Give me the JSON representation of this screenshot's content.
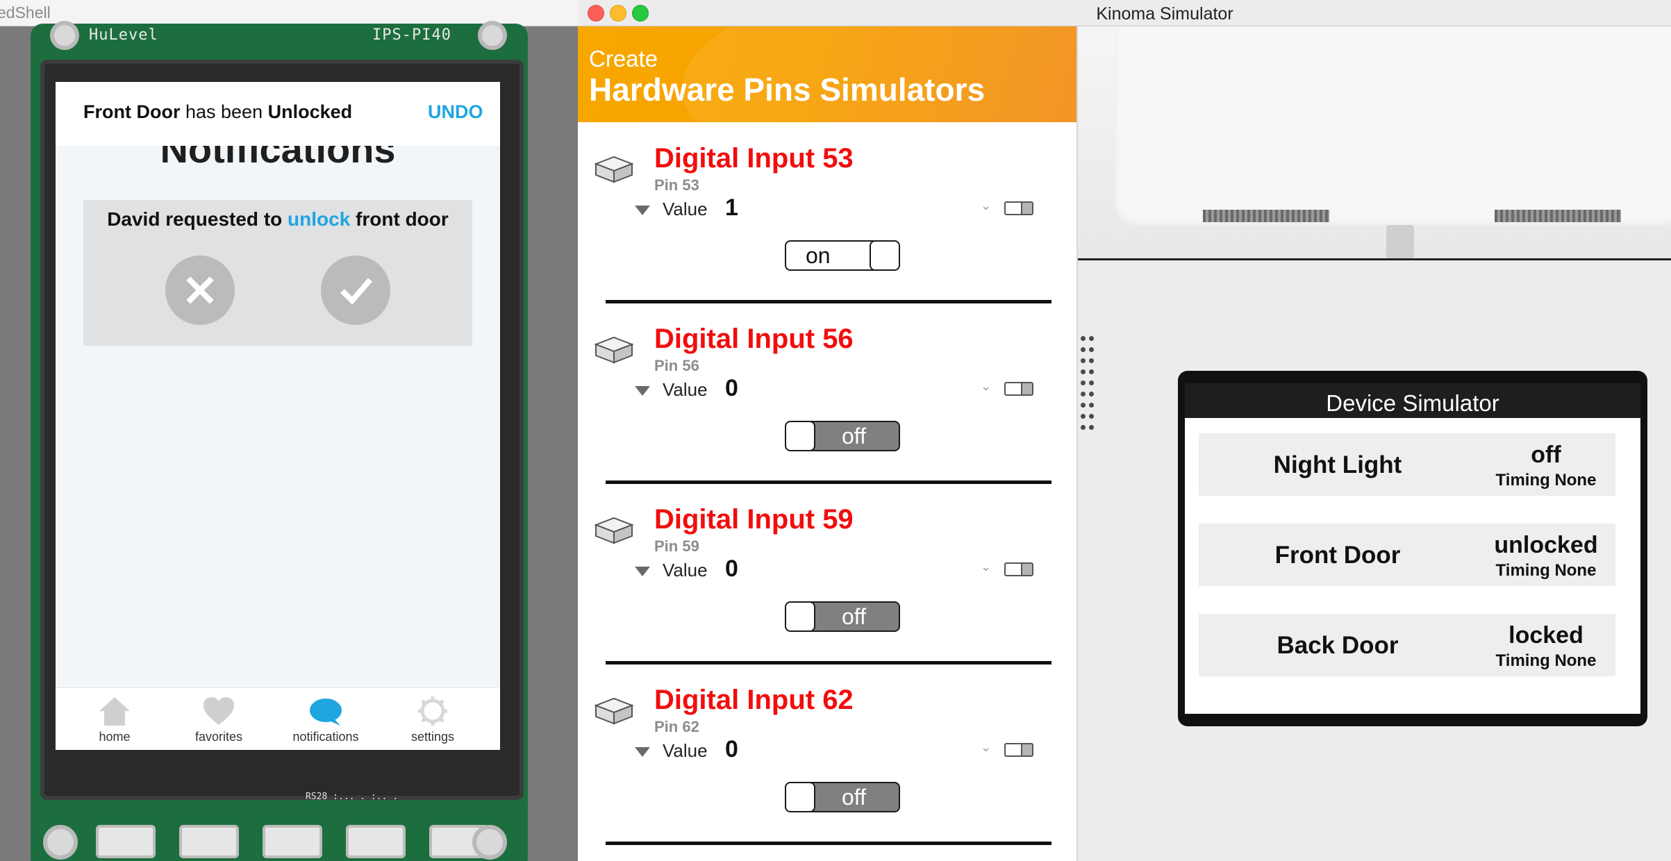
{
  "left_window": {
    "title": "edShell",
    "pcb_label_left": "HuLevel",
    "pcb_label_right": "IPS-PI40",
    "pcb_bottom_label": "RS28 :... . :.. .",
    "toast": {
      "subject": "Front Door",
      "middle": " has been ",
      "state": "Unlocked",
      "undo_label": "UNDO"
    },
    "page_title": "Notifications",
    "request": {
      "before": "David requested to ",
      "action": "unlock",
      "after": " front door"
    },
    "tabs": [
      {
        "label": "home",
        "icon": "home-icon"
      },
      {
        "label": "favorites",
        "icon": "heart-icon"
      },
      {
        "label": "notifications",
        "icon": "chat-bubble-icon"
      },
      {
        "label": "settings",
        "icon": "gear-icon"
      }
    ],
    "active_tab": "notifications",
    "accent_color": "#1fa5e0"
  },
  "right_window": {
    "title": "Kinoma Simulator",
    "pins_panel": {
      "create_label": "Create",
      "title": "Hardware Pins Simulators",
      "value_label": "Value",
      "pins": [
        {
          "name": "Digital Input 53",
          "pin": "Pin 53",
          "value": "1",
          "switch": "on"
        },
        {
          "name": "Digital Input 56",
          "pin": "Pin 56",
          "value": "0",
          "switch": "off"
        },
        {
          "name": "Digital Input 59",
          "pin": "Pin 59",
          "value": "0",
          "switch": "off"
        },
        {
          "name": "Digital Input 62",
          "pin": "Pin 62",
          "value": "0",
          "switch": "off"
        }
      ],
      "accent_color": "#f20d0d",
      "header_color": "#f7a800"
    },
    "device_simulator": {
      "title": "Device Simulator",
      "devices": [
        {
          "name": "Night Light",
          "state": "off",
          "timing": "Timing None"
        },
        {
          "name": "Front Door",
          "state": "unlocked",
          "timing": "Timing None"
        },
        {
          "name": "Back Door",
          "state": "locked",
          "timing": "Timing None"
        }
      ]
    }
  }
}
